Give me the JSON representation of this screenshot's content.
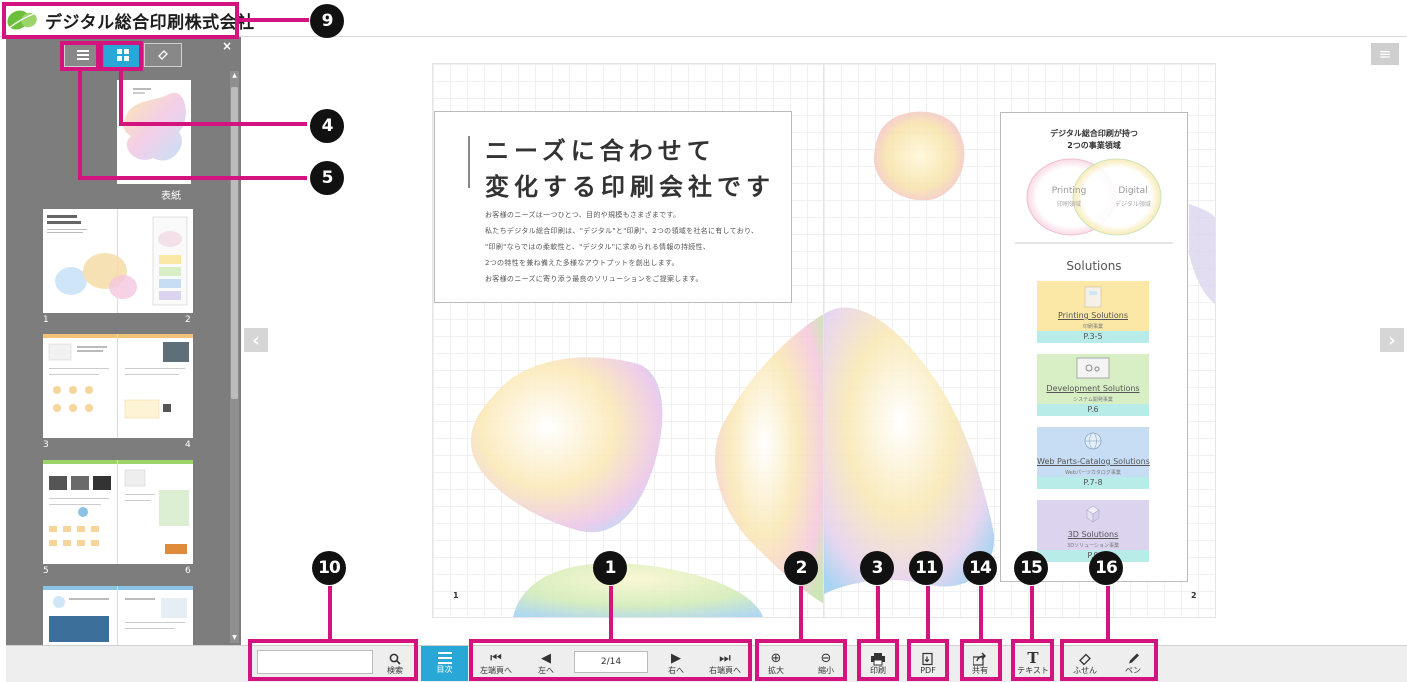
{
  "header": {
    "company_name": "デジタル総合印刷株式会社"
  },
  "sidebar": {
    "tabs": [
      {
        "name": "list",
        "icon": "list-icon"
      },
      {
        "name": "thumbnails",
        "icon": "grid-icon",
        "active": true
      },
      {
        "name": "memo",
        "icon": "tag-icon"
      }
    ],
    "close_glyph": "×",
    "cover_label": "表紙",
    "page_numbers": [
      "1",
      "2",
      "3",
      "4",
      "5",
      "6"
    ]
  },
  "page": {
    "headline_1": "ニーズに合わせて",
    "headline_2": "変化する印刷会社です",
    "body": [
      "お客様のニーズは一つひとつ、目的や規模もさまざまです。",
      "私たちデジタル総合印刷は、\"デジタル\"と\"印刷\"、2つの領域を社名に有しており、",
      "\"印刷\"ならではの柔軟性と、\"デジタル\"に求められる情報の持続性、",
      "2つの特性を兼ね備えた多様なアウトプットを創出します。",
      "お客様のニーズに寄り添う最良のソリューションをご提案します。"
    ],
    "panel_title_1": "デジタル総合印刷が持つ",
    "panel_title_2": "2つの事業領域",
    "venn_left": "Printing",
    "venn_left_sub": "印刷領域",
    "venn_right": "Digital",
    "venn_right_sub": "デジタル領域",
    "solutions_heading": "Solutions",
    "solutions": [
      {
        "name": "Printing Solutions",
        "sub": "印刷事業",
        "pages": "P.3-5",
        "color": "#fbe7a6"
      },
      {
        "name": "Development Solutions",
        "sub": "システム開発事業",
        "pages": "P.6",
        "color": "#d8efc6"
      },
      {
        "name": "Web Parts-Catalog Solutions",
        "sub": "Webパーツカタログ事業",
        "pages": "P.7-8",
        "color": "#c7ddf3"
      },
      {
        "name": "3D Solutions",
        "sub": "3Dソリューション事業",
        "pages": "P.9",
        "color": "#dcd4ee"
      }
    ],
    "left_page_number": "1",
    "right_page_number": "2"
  },
  "toolbar": {
    "search_label": "検索",
    "search_value": "",
    "toc_label": "目次",
    "first_page_label": "左端頁へ",
    "prev_label": "左へ",
    "page_indicator": "2/14",
    "next_label": "右へ",
    "last_page_label": "右端頁へ",
    "zoom_in_label": "拡大",
    "zoom_out_label": "縮小",
    "print_label": "印刷",
    "pdf_label": "PDF",
    "share_label": "共有",
    "text_label": "テキスト",
    "sticky_label": "ふせん",
    "pen_label": "ペン"
  },
  "callouts": {
    "c1": "1",
    "c2": "2",
    "c3": "3",
    "c4": "4",
    "c5": "5",
    "c9": "9",
    "c10": "10",
    "c11": "11",
    "c14": "14",
    "c15": "15",
    "c16": "16"
  },
  "colors": {
    "accent": "#29a8d8",
    "annotation": "#d4147e",
    "sidebar_bg": "#7d7d7d",
    "callout_bg": "#111111"
  }
}
